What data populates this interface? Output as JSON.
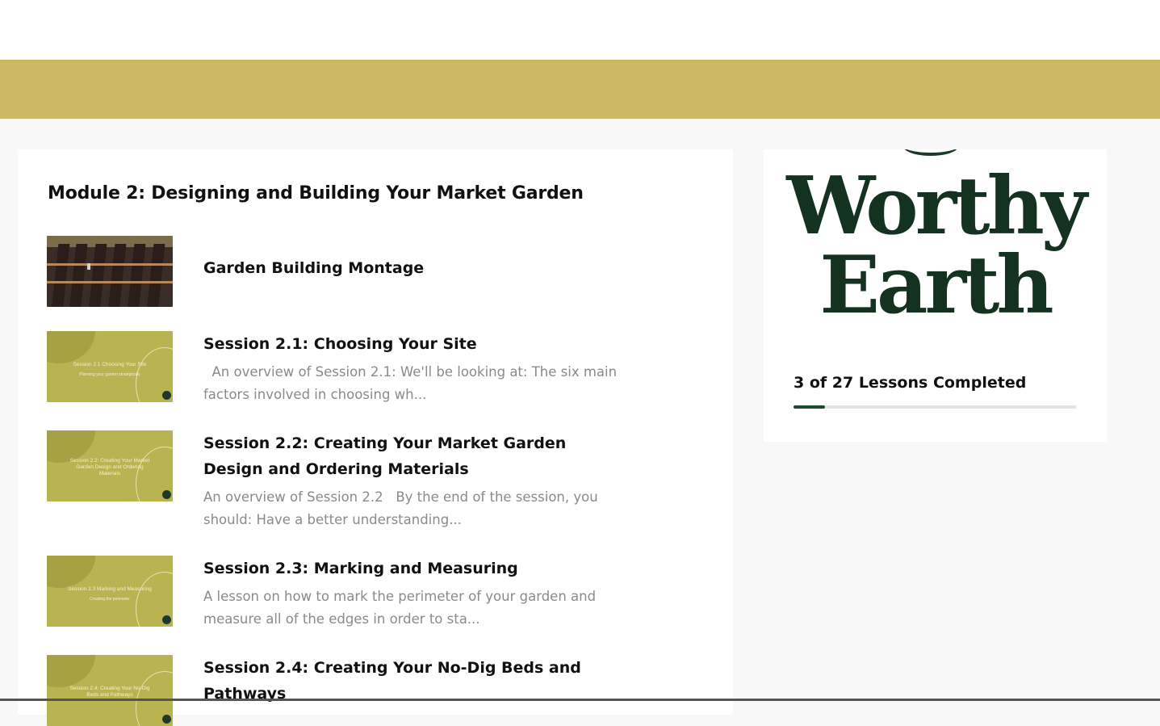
{
  "colors": {
    "gold_band": "#ccb862",
    "brand_green": "#13321f",
    "progress_fill": "#1f4a32"
  },
  "module": {
    "title": "Module 2: Designing and Building Your Market Garden"
  },
  "lessons": [
    {
      "title": "Garden Building Montage",
      "description": "",
      "thumbnail_text": []
    },
    {
      "title": "Session 2.1: Choosing Your Site",
      "description": "  An overview of Session 2.1: We'll be looking at: The six main factors involved in choosing wh...",
      "thumbnail_text": [
        "Session 2.1 Choosing Your Site",
        "Planning your garden strategically"
      ]
    },
    {
      "title": "Session 2.2: Creating Your Market Garden Design and Ordering Materials",
      "description": "An overview of Session 2.2   By the end of the session, you should: Have a better understanding...",
      "thumbnail_text": [
        "Session 2.2: Creating Your Market Garden Design and Ordering Materials"
      ]
    },
    {
      "title": "Session 2.3: Marking and Measuring",
      "description": "A lesson on how to mark the perimeter of your garden and measure all of the edges in order to sta...",
      "thumbnail_text": [
        "Session 2.3 Marking and Measuring",
        "Creating the perimeter"
      ]
    },
    {
      "title": "Session 2.4: Creating Your No-Dig Beds and Pathways",
      "description": "",
      "thumbnail_text": [
        "Session 2.4: Creating Your No-Dig Beds and Pathways"
      ]
    }
  ],
  "sidebar": {
    "logo_line1": "Worthy",
    "logo_line2": "Earth",
    "progress_label": "3 of 27 Lessons Completed",
    "lessons_completed": 3,
    "lessons_total": 27
  }
}
